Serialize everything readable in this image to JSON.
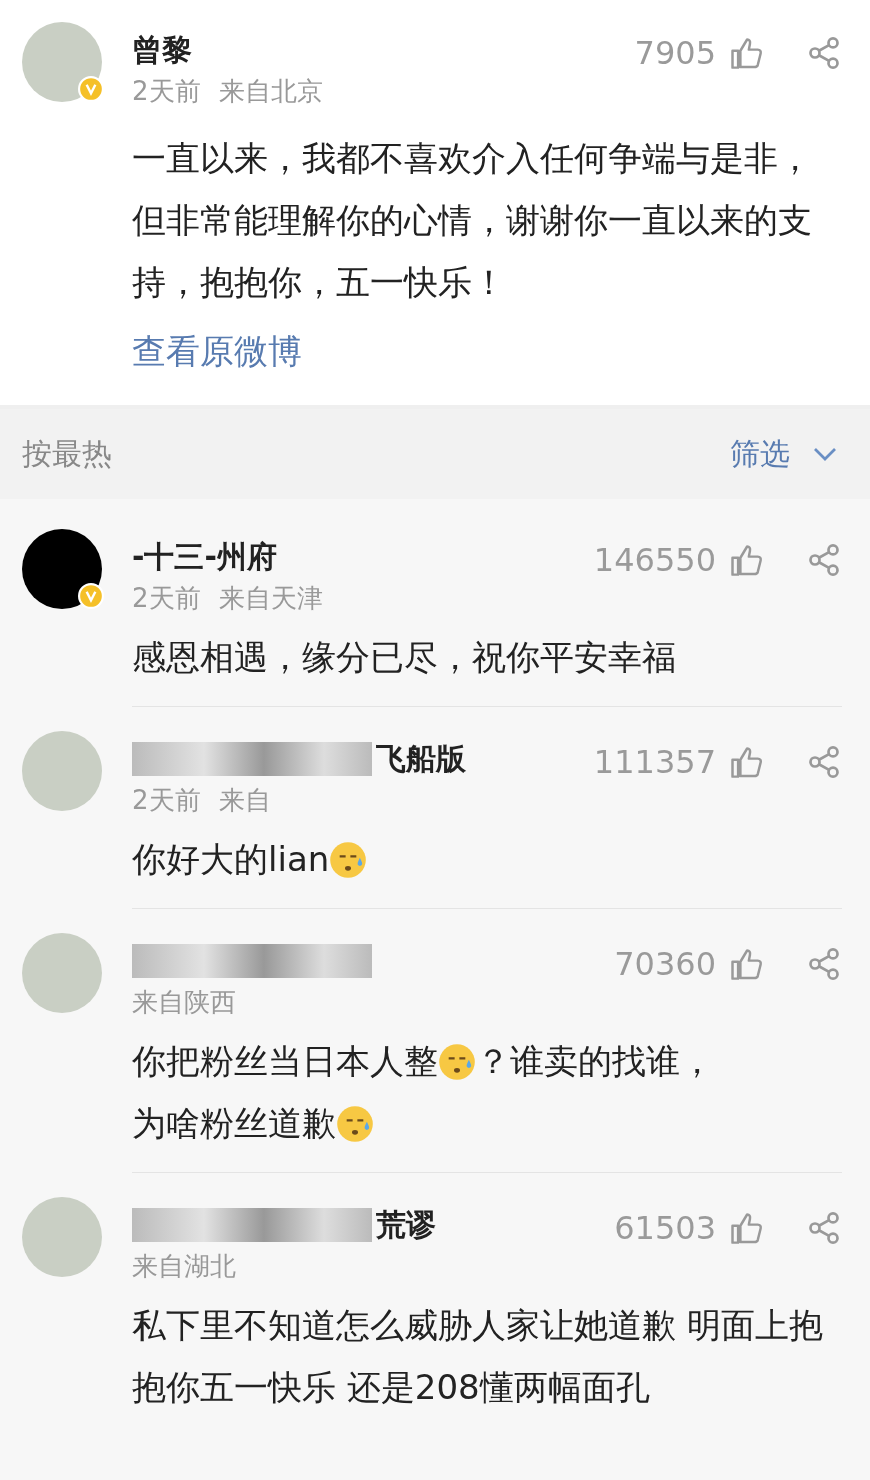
{
  "post": {
    "author": "曾黎",
    "verified": true,
    "time": "2天前",
    "location": "来自北京",
    "likes": "7905",
    "text": "一直以来，我都不喜欢介入任何争端与是非，但非常能理解你的心情，谢谢你一直以来的支持，抱抱你，五一快乐！",
    "link": "查看原微博"
  },
  "sort_bar": {
    "label": "按最热",
    "filter": "筛选"
  },
  "comments": [
    {
      "name": "-十三-州府",
      "name_blurred": false,
      "verified": true,
      "time": "2天前",
      "location": "来自天津",
      "likes": "146550",
      "body": [
        {
          "kind": "text",
          "text": "感恩相遇，缘分已尽，祝你平安幸福"
        }
      ]
    },
    {
      "name": "飞船版",
      "name_blurred": true,
      "verified": false,
      "time": "2天前",
      "location": "来自",
      "likes": "111357",
      "body": [
        {
          "kind": "text",
          "text": "你好大的lian"
        },
        {
          "kind": "emoji"
        }
      ]
    },
    {
      "name_blurred": true,
      "verified": false,
      "location": "来自陕西",
      "likes": "70360",
      "body": [
        {
          "kind": "text",
          "text": "你把粉丝当日本人整"
        },
        {
          "kind": "emoji"
        },
        {
          "kind": "text",
          "text": "？谁卖的找谁，"
        },
        {
          "kind": "text",
          "text": "为啥粉丝道歉"
        },
        {
          "kind": "emoji"
        }
      ]
    },
    {
      "name": "荒谬",
      "name_blurred": true,
      "verified": false,
      "location": "来自湖北",
      "likes": "61503",
      "body": [
        {
          "kind": "text",
          "text": "私下里不知道怎么威胁人家让她道歉 明面上抱抱你五一快乐 还是208懂两幅面孔"
        }
      ]
    }
  ]
}
